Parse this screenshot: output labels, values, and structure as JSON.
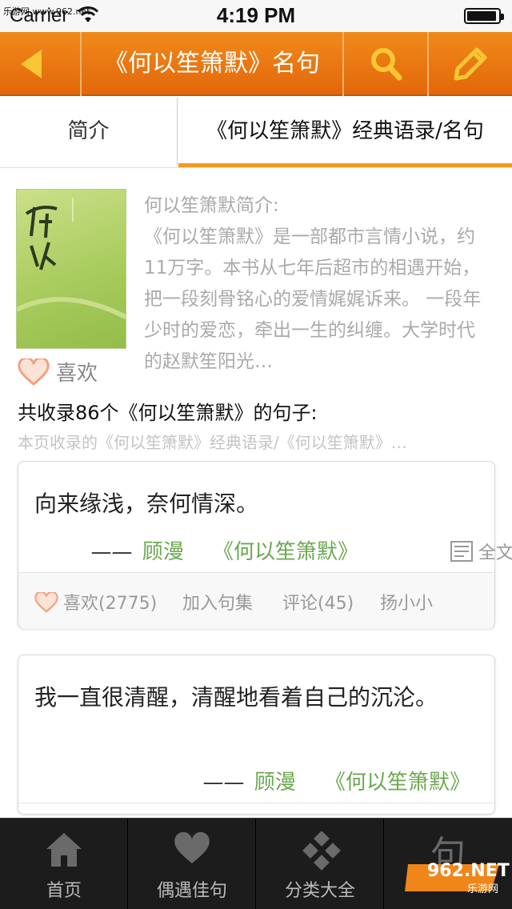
{
  "status_bar": {
    "carrier": "Carrier",
    "watermark": "乐游网 www.962.net",
    "time": "4:19 PM",
    "battery_level": 0.95
  },
  "nav": {
    "title": "《何以笙箫默》名句",
    "back_icon": "back-arrow-icon",
    "search_icon": "search-icon",
    "edit_icon": "pencil-icon",
    "accent": "#ea7512"
  },
  "tabs": [
    {
      "label": "简介",
      "selected": false
    },
    {
      "label": "《何以笙箫默》经典语录/名句",
      "selected": true
    }
  ],
  "intro": {
    "heading": "何以笙箫默简介:",
    "body": "《何以笙箫默》是一部都市言情小说，约11万字。本书从七年后超市的相遇开始，把一段刻骨铭心的爱情娓娓诉来。 一段年少时的爱恋，牵出一生的纠缠。大学时代的赵默笙阳光…",
    "like_label": "喜欢"
  },
  "collection": {
    "total_text": "共收录86个《何以笙箫默》的句子:",
    "subtitle": "本页收录的《何以笙箫默》经典语录/《何以笙箫默》…"
  },
  "quotes": [
    {
      "text": "向来缘浅，奈何情深。",
      "dash": "——",
      "author": "顾漫",
      "book": "《何以笙箫默》",
      "fulltext_label": "全文",
      "actions": {
        "like": "喜欢(2775)",
        "collect": "加入句集",
        "comment": "评论(45)",
        "user": "扬小小"
      }
    },
    {
      "text": "我一直很清醒，清醒地看着自己的沉沦。",
      "dash": "——",
      "author": "顾漫",
      "book": "《何以笙箫默》"
    }
  ],
  "tab_bar": [
    {
      "label": "首页",
      "icon": "home-icon"
    },
    {
      "label": "偶遇佳句",
      "icon": "heart-icon"
    },
    {
      "label": "分类大全",
      "icon": "category-icon"
    },
    {
      "label": "",
      "glyph": "句",
      "icon": "sentence-icon"
    }
  ],
  "watermark": {
    "text": "962.NET",
    "sub": "乐游网"
  }
}
